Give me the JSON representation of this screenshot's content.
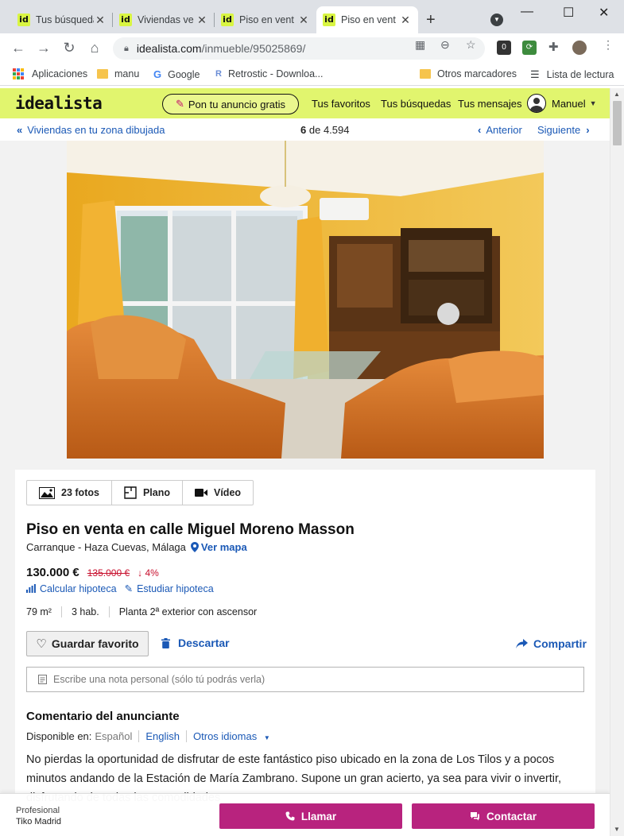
{
  "browser": {
    "tabs": [
      {
        "label": "Tus búsquedas",
        "active": false
      },
      {
        "label": "Viviendas ve",
        "active": false
      },
      {
        "label": "Piso en vent",
        "active": false
      },
      {
        "label": "Piso en vent",
        "active": true
      }
    ],
    "favicon_text": "id",
    "new_tab": "+",
    "url_host": "idealista.com",
    "url_path": "/inmueble/95025869/",
    "bookmarks": {
      "apps": "Aplicaciones",
      "manu": "manu",
      "google": "Google",
      "retrostic": "Retrostic - Downloa...",
      "other": "Otros marcadores",
      "reading": "Lista de lectura"
    },
    "google_glyph": "G",
    "retrostic_glyph": "R"
  },
  "header": {
    "logo": "idealista",
    "publish": "Pon tu anuncio gratis",
    "nav": {
      "favorites": "Tus favoritos",
      "searches": "Tus búsquedas",
      "messages": "Tus mensajes"
    },
    "user": "Manuel"
  },
  "subnav": {
    "back": "Viviendas en tu zona dibujada",
    "position": "6",
    "of": "de",
    "total": "4.594",
    "prev": "Anterior",
    "next": "Siguiente"
  },
  "listing": {
    "media": {
      "photos_count": "23",
      "photos_label": "fotos",
      "plan": "Plano",
      "video": "Vídeo"
    },
    "title": "Piso en venta en calle Miguel Moreno Masson",
    "location": "Carranque - Haza Cuevas, Málaga",
    "map_link": "Ver mapa",
    "price": "130.000 €",
    "old_price": "135.000 €",
    "drop": "↓ 4%",
    "calc_mortgage": "Calcular hipoteca",
    "study_mortgage": "Estudiar hipoteca",
    "features": [
      "79 m²",
      "3 hab.",
      "Planta 2ª exterior con ascensor"
    ],
    "save_favorite": "Guardar favorito",
    "discard": "Descartar",
    "share": "Compartir",
    "note_placeholder": "Escribe una nota personal (sólo tú podrás verla)"
  },
  "comment": {
    "title": "Comentario del anunciante",
    "available_in": "Disponible en:",
    "languages": {
      "current": "Español",
      "english": "English",
      "other": "Otros idiomas"
    },
    "text": "No pierdas la oportunidad de disfrutar de este fantástico piso ubicado en la zona de Los Tilos y a pocos minutos andando de la Estación de María Zambrano. Supone un gran acierto, ya sea para vivir o invertir, disfrutando de todas las comodidades"
  },
  "footer": {
    "pro_label": "Profesional",
    "agency": "Tiko Madrid",
    "call": "Llamar",
    "contact": "Contactar"
  },
  "colors": {
    "brand_lime": "#e1f56e",
    "link_blue": "#1b59b6",
    "cta_magenta": "#b8237e",
    "price_drop_red": "#c8102e"
  }
}
